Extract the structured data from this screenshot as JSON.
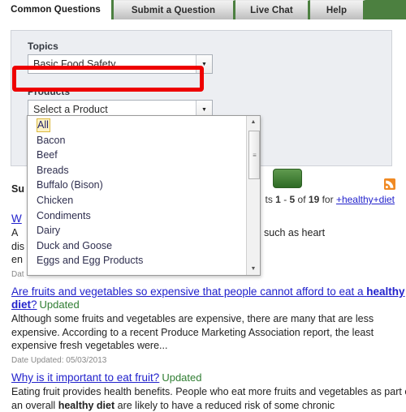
{
  "tabs": [
    {
      "label": "Common Questions",
      "active": true
    },
    {
      "label": "Submit a Question",
      "active": false
    },
    {
      "label": "Live Chat",
      "active": false
    },
    {
      "label": "Help",
      "active": false
    }
  ],
  "search_panel": {
    "topics_label": "Topics",
    "topics_value": "Basic Food Safety",
    "products_label": "Products",
    "products_value": "Select a Product",
    "highlight_color": "#ee0000",
    "submit_button_color": "#4c8040",
    "dropdown_arrow": "▼"
  },
  "product_dropdown": {
    "open": true,
    "selected": "All",
    "items": [
      "All",
      "Bacon",
      "Beef",
      "Breads",
      "Buffalo (Bison)",
      "Chicken",
      "Condiments",
      "Dairy",
      "Duck and Goose",
      "Eggs and Egg Products"
    ],
    "scroll_up_glyph": "▲",
    "scroll_down_glyph": "▼",
    "thumb_grip": "≡"
  },
  "results": {
    "summary_label": "Su",
    "count_prefix": "ts ",
    "count_from": "1",
    "count_dash": " - ",
    "count_to": "5",
    "count_of": " of ",
    "count_total": "19",
    "count_for": " for ",
    "count_query": "+healthy+diet",
    "rss_label": "rss-feed-icon",
    "items": [
      {
        "title_pre": "W",
        "title_bold": "",
        "title_post": "",
        "updated": "",
        "snippet_parts": [
          "A ",
          "",
          "ases such as heart"
        ],
        "snippet_line2": "dis                                                  Dietary Guidelines",
        "snippet_line3": "en",
        "date": "Dat"
      },
      {
        "title_pre": "Are fruits and vegetables so expensive that people cannot afford to eat a ",
        "title_bold": "healthy diet",
        "title_post": "?",
        "updated": "Updated",
        "snippet": "Although some fruits and vegetables are expensive, there are many that are less expensive. According to a recent Produce Marketing Association report, the least expensive fresh vegetables were...",
        "date": "Date Updated: 05/03/2013"
      },
      {
        "title_pre": "Why is it important to eat fruit?",
        "title_bold": "",
        "title_post": "",
        "updated": "Updated",
        "snippet_a": "Eating fruit provides health benefits. People who eat more fruits and vegetables as part of an overall ",
        "snippet_bold": "healthy diet",
        "snippet_b": " are likely to have a reduced risk of some chronic",
        "date": ""
      }
    ]
  }
}
